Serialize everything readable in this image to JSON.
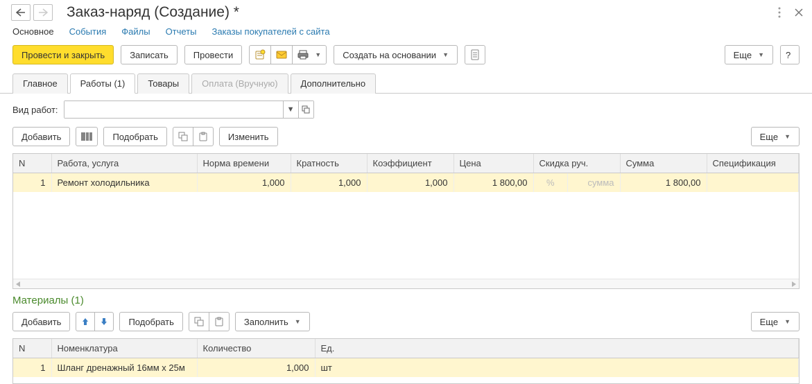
{
  "header": {
    "title": "Заказ-наряд (Создание) *"
  },
  "linkbar": {
    "main": "Основное",
    "events": "События",
    "files": "Файлы",
    "reports": "Отчеты",
    "site_orders": "Заказы покупателей с сайта"
  },
  "toolbar": {
    "post_close": "Провести и закрыть",
    "write": "Записать",
    "post": "Провести",
    "create_based": "Создать на основании",
    "more": "Еще",
    "help": "?"
  },
  "tabs": {
    "main": "Главное",
    "works": "Работы (1)",
    "goods": "Товары",
    "payment": "Оплата (Вручную)",
    "extra": "Дополнительно"
  },
  "form": {
    "work_type_label": "Вид работ:",
    "work_type_value": ""
  },
  "worksbar": {
    "add": "Добавить",
    "pick": "Подобрать",
    "change": "Изменить",
    "more": "Еще"
  },
  "works_table": {
    "headers": {
      "n": "N",
      "work": "Работа, услуга",
      "norm": "Норма времени",
      "mult": "Кратность",
      "coef": "Коэффициент",
      "price": "Цена",
      "disc": "Скидка руч.",
      "sum": "Сумма",
      "spec": "Спецификация"
    },
    "row1": {
      "n": "1",
      "work": "Ремонт холодильника",
      "norm": "1,000",
      "mult": "1,000",
      "coef": "1,000",
      "price": "1 800,00",
      "disc_pct": "%",
      "disc_sum": "сумма",
      "sum": "1 800,00",
      "spec": ""
    }
  },
  "materials": {
    "title": "Материалы (1)",
    "add": "Добавить",
    "pick": "Подобрать",
    "fill": "Заполнить",
    "more": "Еще"
  },
  "materials_table": {
    "headers": {
      "n": "N",
      "nom": "Номенклатура",
      "qty": "Количество",
      "ed": "Ед."
    },
    "row1": {
      "n": "1",
      "nom": "Шланг дренажный 16мм х 25м",
      "qty": "1,000",
      "ed": "шт"
    }
  }
}
